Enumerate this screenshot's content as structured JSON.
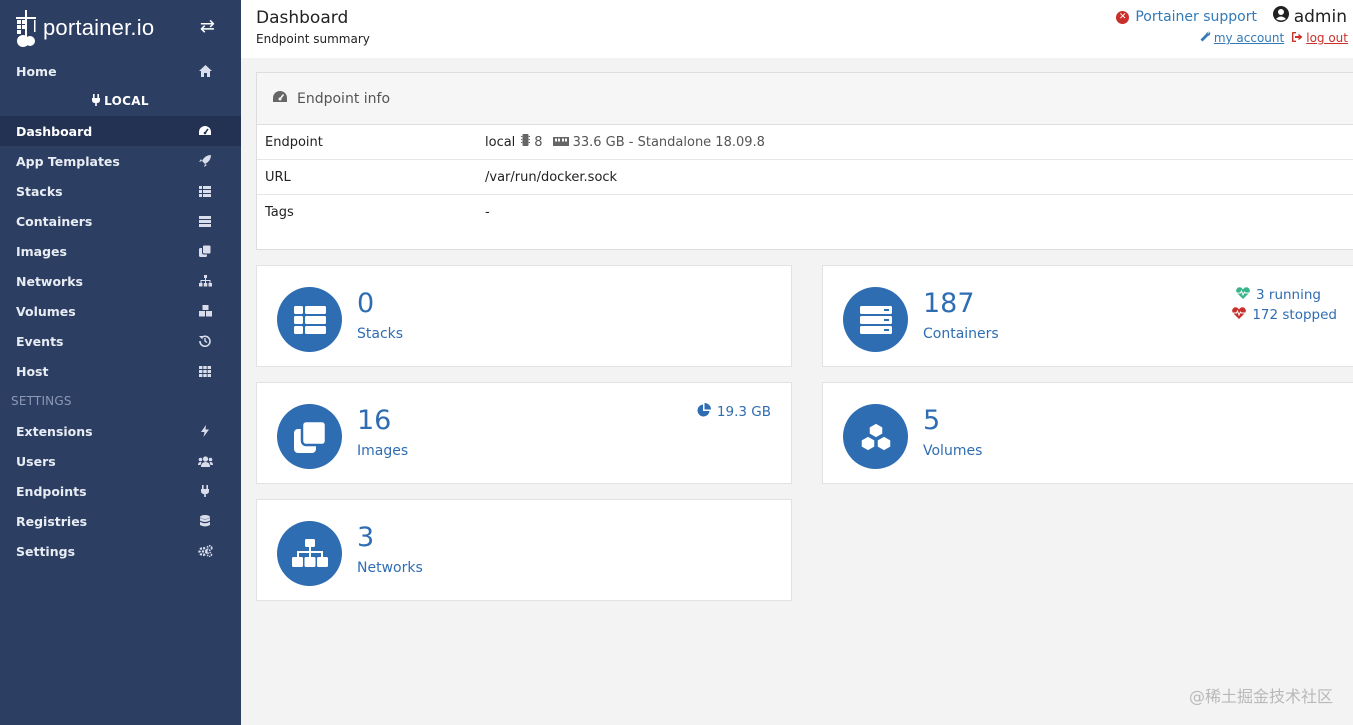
{
  "brand": {
    "name": "portainer.io"
  },
  "sidebar": {
    "items_top": [
      {
        "label": "Home",
        "icon": "home-icon"
      }
    ],
    "endpoint_label": "LOCAL",
    "items": [
      {
        "label": "Dashboard",
        "icon": "dashboard-icon",
        "active": true
      },
      {
        "label": "App Templates",
        "icon": "rocket-icon"
      },
      {
        "label": "Stacks",
        "icon": "th-list-icon"
      },
      {
        "label": "Containers",
        "icon": "server-icon"
      },
      {
        "label": "Images",
        "icon": "clone-icon"
      },
      {
        "label": "Networks",
        "icon": "sitemap-icon"
      },
      {
        "label": "Volumes",
        "icon": "cubes-icon"
      },
      {
        "label": "Events",
        "icon": "history-icon"
      },
      {
        "label": "Host",
        "icon": "th-icon"
      }
    ],
    "settings_heading": "SETTINGS",
    "settings_items": [
      {
        "label": "Extensions",
        "icon": "bolt-icon"
      },
      {
        "label": "Users",
        "icon": "users-icon"
      },
      {
        "label": "Endpoints",
        "icon": "plug-icon"
      },
      {
        "label": "Registries",
        "icon": "database-icon"
      },
      {
        "label": "Settings",
        "icon": "cogs-icon"
      }
    ]
  },
  "header": {
    "title": "Dashboard",
    "subtitle": "Endpoint summary",
    "support_label": "Portainer support",
    "username": "admin",
    "my_account_label": " my account ",
    "logout_label": " log out"
  },
  "endpoint_info": {
    "title": "Endpoint info",
    "rows": {
      "endpoint": {
        "key": "Endpoint",
        "name": "local",
        "cpus": "8",
        "memory": "33.6 GB - Standalone 18.09.8"
      },
      "url": {
        "key": "URL",
        "value": "/var/run/docker.sock"
      },
      "tags": {
        "key": "Tags",
        "value": "-"
      }
    }
  },
  "widgets": {
    "stacks": {
      "count": "0",
      "label": "Stacks"
    },
    "containers": {
      "count": "187",
      "label": "Containers",
      "running": "3 running",
      "stopped": "172 stopped"
    },
    "images": {
      "count": "16",
      "label": "Images",
      "size": "19.3 GB"
    },
    "volumes": {
      "count": "5",
      "label": "Volumes"
    },
    "networks": {
      "count": "3",
      "label": "Networks"
    }
  },
  "colors": {
    "sidebar": "#2d3e63",
    "accent": "#2f6db3",
    "running": "#38b48b",
    "stopped": "#c9302c"
  },
  "watermark": "@稀土掘金技术社区"
}
